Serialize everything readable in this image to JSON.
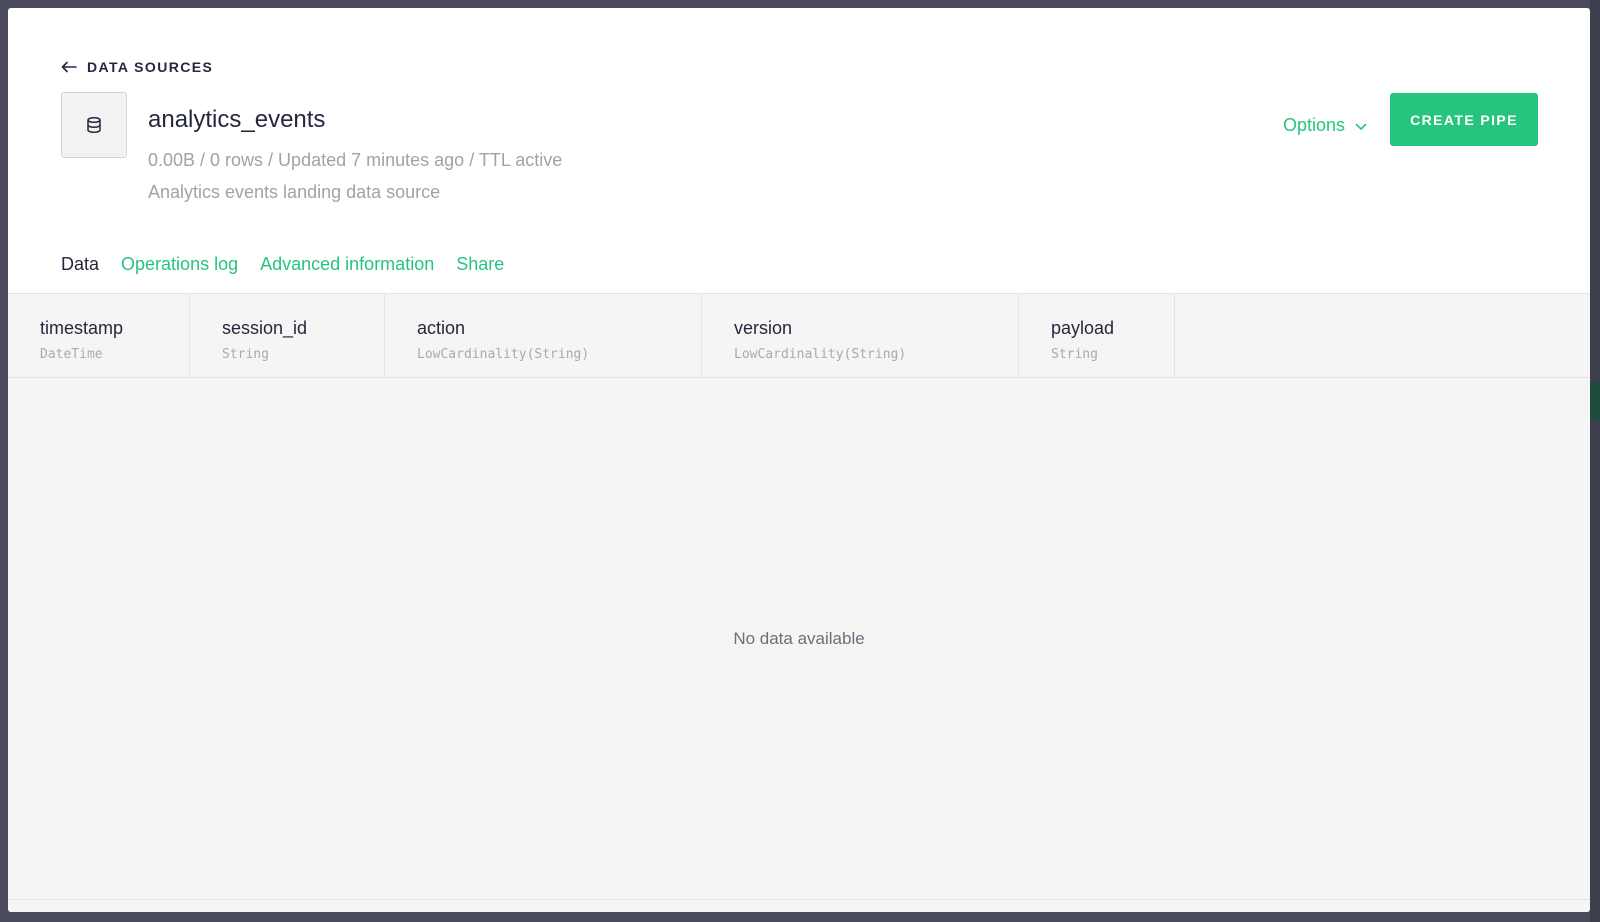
{
  "header": {
    "back_label": "DATA SOURCES",
    "datasource_icon": "database-icon",
    "title": "analytics_events",
    "meta": "0.00B / 0 rows / Updated 7 minutes ago / TTL active",
    "description": "Analytics events landing data source"
  },
  "actions": {
    "options_label": "Options",
    "create_pipe_label": "CREATE PIPE"
  },
  "tabs": [
    {
      "label": "Data",
      "active": true
    },
    {
      "label": "Operations log",
      "active": false
    },
    {
      "label": "Advanced information",
      "active": false
    },
    {
      "label": "Share",
      "active": false
    }
  ],
  "table": {
    "columns": [
      {
        "name": "timestamp",
        "type": "DateTime"
      },
      {
        "name": "session_id",
        "type": "String"
      },
      {
        "name": "action",
        "type": "LowCardinality(String)"
      },
      {
        "name": "version",
        "type": "LowCardinality(String)"
      },
      {
        "name": "payload",
        "type": "String"
      }
    ],
    "empty_message": "No data available"
  },
  "colors": {
    "accent": "#27c47f",
    "text_primary": "#25283d",
    "text_muted": "#a0a2ab",
    "backdrop": "#4a4b5a"
  }
}
